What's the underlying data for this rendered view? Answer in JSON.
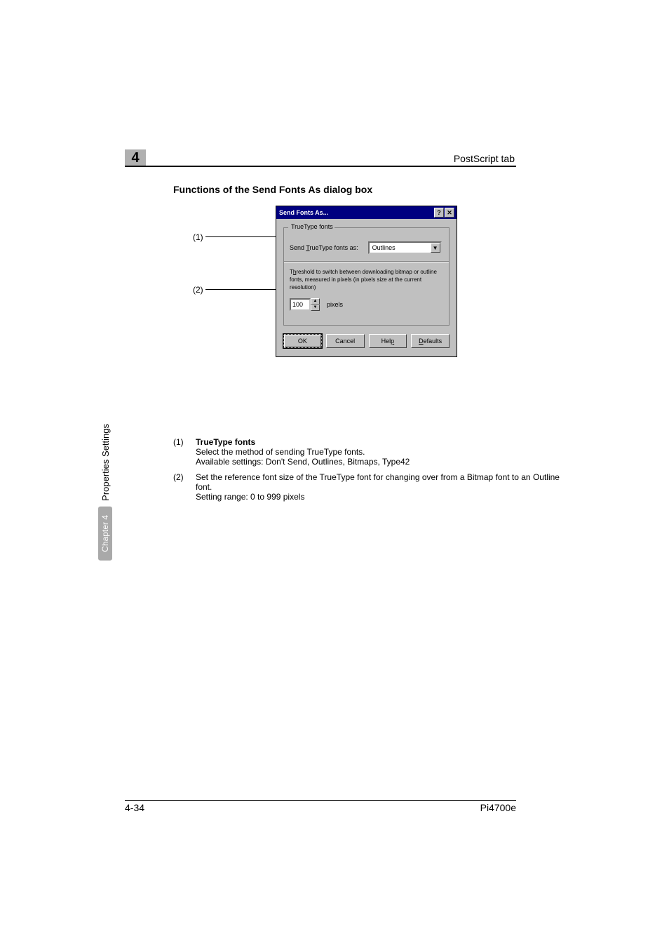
{
  "header": {
    "chapter_number": "4",
    "tab_name": "PostScript tab"
  },
  "section_title": "Functions of the Send Fonts As dialog box",
  "callouts": {
    "c1": "(1)",
    "c2": "(2)"
  },
  "dialog": {
    "title": "Send Fonts As...",
    "help_btn": "?",
    "close_btn": "✕",
    "group": {
      "legend": "TrueType fonts",
      "send_label_pre": "Send ",
      "send_label_u": "T",
      "send_label_post": "rueType fonts as:",
      "select_value": "Outlines",
      "threshold_desc_pre": "T",
      "threshold_desc_u": "h",
      "threshold_desc_post": "reshold to switch between downloading bitmap or outline fonts, measured in pixels (in pixels size at the current resolution)",
      "spinner_value": "100",
      "pixels_label": "pixels"
    },
    "buttons": {
      "ok": "OK",
      "cancel": "Cancel",
      "help_pre": "Hel",
      "help_u": "p",
      "defaults_u": "D",
      "defaults_post": "efaults"
    }
  },
  "list": {
    "i1": {
      "num": "(1)",
      "title": "TrueType fonts",
      "line1": "Select the method of sending TrueType fonts.",
      "line2": "Available settings: Don't Send, Outlines, Bitmaps, Type42"
    },
    "i2": {
      "num": "(2)",
      "line1": "Set the reference font size of the TrueType font for changing over from a Bitmap font to an Outline font.",
      "line2": "Setting range: 0 to 999 pixels"
    }
  },
  "side": {
    "chip": "Chapter 4",
    "label": "Properties Settings"
  },
  "footer": {
    "left": "4-34",
    "right": "Pi4700e"
  },
  "chart_data": null
}
